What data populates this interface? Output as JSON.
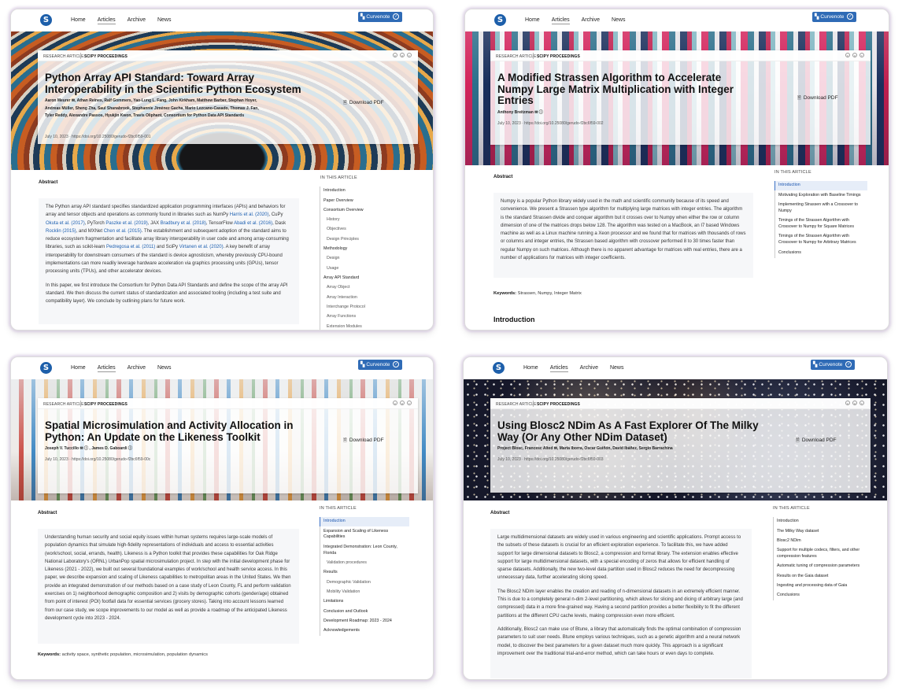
{
  "nav": {
    "home": "Home",
    "articles": "Articles",
    "archive": "Archive",
    "news": "News",
    "curvenote": "Curvenote",
    "logo_icon": "scipy-logo-icon",
    "curvenote_icon": "curvenote-grid-icon"
  },
  "labels": {
    "research_article": "RESEARCH ARTICLE",
    "venue": "SCIPY PROCEEDINGS",
    "download_pdf": "Download PDF",
    "abstract": "Abstract",
    "in_this_article": "IN THIS ARTICLE",
    "keywords": "Keywords:",
    "introduction": "Introduction"
  },
  "articles": [
    {
      "title": "Python Array API Standard: Toward Array Interoperability in the Scientific Python Ecosystem",
      "authors_line1": "Aaron Meurer ✉,   Athan Reines,   Ralf Gommers,   Yao-Lung L. Fang,   John Kirkham,   Matthew Barber,   Stephan Hoyer,",
      "authors_line2": "Andreas Müller,   Sheng Zha,   Saul Shanabrook,   Stephannie Jiménez Gacha,   Mario Lezcano-Casado,   Thomas J. Fan,",
      "authors_line3": "Tyler Reddy,   Alexandre Passos,   Hyukjin Kwon,   Travis Oliphant,   Consortium for Python Data API Standards",
      "date_doi": "July 10, 2023  ·  https://doi.org/10.25080/gerudo-f2bc6f59-001",
      "abstract_p1a": "The Python array API standard specifies standardized application programming interfaces (APIs) and behaviors for array and tensor objects and operations as commonly found in libraries such as NumPy ",
      "abstract_c1": "Harris et al. (2020)",
      "abstract_p1b": ", CuPy ",
      "abstract_c2": "Okuta et al. (2017)",
      "abstract_p1c": ", PyTorch ",
      "abstract_c3": "Paszke et al. (2019)",
      "abstract_p1d": ", JAX ",
      "abstract_c4": "Bradbury et al. (2018)",
      "abstract_p1e": ", TensorFlow ",
      "abstract_c5": "Abadi et al. (2016)",
      "abstract_p1f": ", Dask ",
      "abstract_c6": "Rocklin (2015)",
      "abstract_p1g": ", and MXNet ",
      "abstract_c7": "Chen et al. (2015)",
      "abstract_p1h": ". The establishment and subsequent adoption of the standard aims to reduce ecosystem fragmentation and facilitate array library interoperability in user code and among array-consuming libraries, such as scikit-learn ",
      "abstract_c8": "Pedregosa et al. (2011)",
      "abstract_p1i": " and SciPy ",
      "abstract_c9": "Virtanen et al. (2020)",
      "abstract_p1j": ". A key benefit of array interoperability for downstream consumers of the standard is device agnosticism, whereby previously CPU-bound implementations can more readily leverage hardware acceleration via graphics processing units (GPUs), tensor processing units (TPUs), and other accelerator devices.",
      "abstract_p2": "In this paper, we first introduce the Consortium for Python Data API Standards and define the scope of the array API standard. We then discuss the current status of standardization and associated tooling (including a test suite and compatibility layer). We conclude by outlining plans for future work.",
      "toc": [
        "Introduction",
        "Paper Overview",
        "Consortium Overview",
        "History",
        "Objectives",
        "Design Principles",
        "Methodology",
        "Design",
        "Usage",
        "Array API Standard",
        "Array Object",
        "Array Interaction",
        "Interchange Protocol",
        "Array Functions",
        "Extension Modules"
      ]
    },
    {
      "title": "A Modified Strassen Algorithm to Accelerate Numpy Large Matrix Multiplication with Integer Entries",
      "authors_line1": "Anthony Breitzman ✉ ⓘ",
      "date_doi": "July 10, 2023  ·  https://doi.org/10.25080/gerudo-f2bc6f59-002",
      "abstract_p1": "Numpy is a popular Python library widely used in the math and scientific community because of its speed and convenience. We present a Strassen type algorithm for multiplying large matrices with integer entries. The algorithm is the standard Strassen divide and conquer algorithm but it crosses over to Numpy when either the row or column dimension of one of the matrices drops below 128. The algorithm was tested on a MacBook, an I7 based Windows machine as well as a Linux machine running a Xeon processor and we found that for matrices with thousands of rows or columns and integer entries, the Strassen based algorithm with crossover performed 8 to 30 times faster than regular Numpy on such matrices. Although there is no apparent advantage for matrices with real entries, there are a number of applications for matrices with integer coefficients.",
      "keywords": "Strassen, Numpy, Integer Matrix",
      "toc": [
        "Introduction",
        "Motivating Exploration with Baseline Timings",
        "Implementing Strassen with a Crossover to Numpy",
        "Timings of the Strassen Algorithm with Crossover to Numpy for Square Matrices",
        "Timings of the Strassen Algorithm with Crossover to Numpy for Arbitrary Matrices",
        "Conclusions"
      ]
    },
    {
      "title": "Spatial Microsimulation and Activity Allocation in Python: An Update on the Likeness Toolkit",
      "authors_line1": "Joseph V. Tuccillo ✉ ⓘ ,   James D. Gaboardi ⓘ",
      "date_doi": "July 10, 2023  ·  https://doi.org/10.25080/gerudo-f2bc6f59-00c",
      "abstract_p1": "Understanding human security and social equity issues within human systems requires large-scale models of population dynamics that simulate high-fidelity representations of individuals and access to essential activities (work/school, social, errands, health). Likeness is a Python toolkit that provides these capabilities for Oak Ridge National Laboratory's (ORNL) UrbanPop spatial microsimulation project. In step with the initial development phase for Likeness (2021 - 2022), we built out several foundational examples of work/school and health service access. In this paper, we describe expansion and scaling of Likeness capabilities to metropolitan areas in the United States. We then provide an integrated demonstration of our methods based on a case study of Leon County, FL and perform validation exercises on 1) neighborhood demographic composition and 2) visits by demographic cohorts (gender/age) obtained from point of interest (POI) footfall data for essential services (grocery stores). Taking into account lessons learned from our case study, we scope improvements to our model as well as provide a roadmap of the anticipated Likeness development cycle into 2023 - 2024.",
      "keywords": "activity space, synthetic population, microsimulation, population dynamics",
      "toc": [
        "Introduction",
        "Expansion and Scaling of Likeness Capabilities",
        "Integrated Demonstration: Leon County, Florida",
        "Validation procedures",
        "Results",
        "Demographic Validation",
        "Mobility Validation",
        "Limitations",
        "Conclusion and Outlook",
        "Development Roadmap: 2023 - 2024",
        "Acknowledgements"
      ]
    },
    {
      "title": "Using Blosc2 NDim As A Fast Explorer Of The Milky Way (Or Any Other NDim Dataset)",
      "authors_line1": "Project Blosc,   Francesc Alted ✉,   Marta Iborra,   Oscar Guiñón,   David Ibáñez,   Sergio Barrachina",
      "date_doi": "July 10, 2023  ·  https://doi.org/10.25080/gerudo-f2bc6f59-003",
      "abstract_p1": "Large multidimensional datasets are widely used in various engineering and scientific applications. Prompt access to the subsets of these datasets is crucial for an efficient exploration experience. To facilitate this, we have added support for large dimensional datasets to Blosc2, a compression and format library. The extension enables effective support for large multidimensional datasets, with a special encoding of zeros that allows for efficient handling of sparse datasets. Additionally, the new two-level data partition used in Blosc2 reduces the need for decompressing unnecessary data, further accelerating slicing speed.",
      "abstract_p2": "The Blosc2 NDim layer enables the creation and reading of n-dimensional datasets in an extremely efficient manner. This is due to a completely general n-dim 2-level partitioning, which allows for slicing and dicing of arbitrary large (and compressed) data in a more fine-grained way. Having a second partition provides a better flexibility to fit the different partitions at the different CPU cache levels, making compression even more efficient.",
      "abstract_p3": "Additionally, Blosc2 can make use of Btune, a library that automatically finds the optimal combination of compression parameters to suit user needs. Btune employs various techniques, such as a genetic algorithm and a neural network model, to discover the best parameters for a given dataset much more quickly. This approach is a significant improvement over the traditional trial-and-error method, which can take hours or even days to complete.",
      "toc": [
        "Introduction",
        "The Milky Way dataset",
        "Blosc2 NDim",
        "Support for multiple codecs, filters, and other compression features",
        "Automatic tuning of compression parameters",
        "Results on the Gaia dataset",
        "Ingesting and processing data of Gaia",
        "Conclusions"
      ]
    }
  ]
}
